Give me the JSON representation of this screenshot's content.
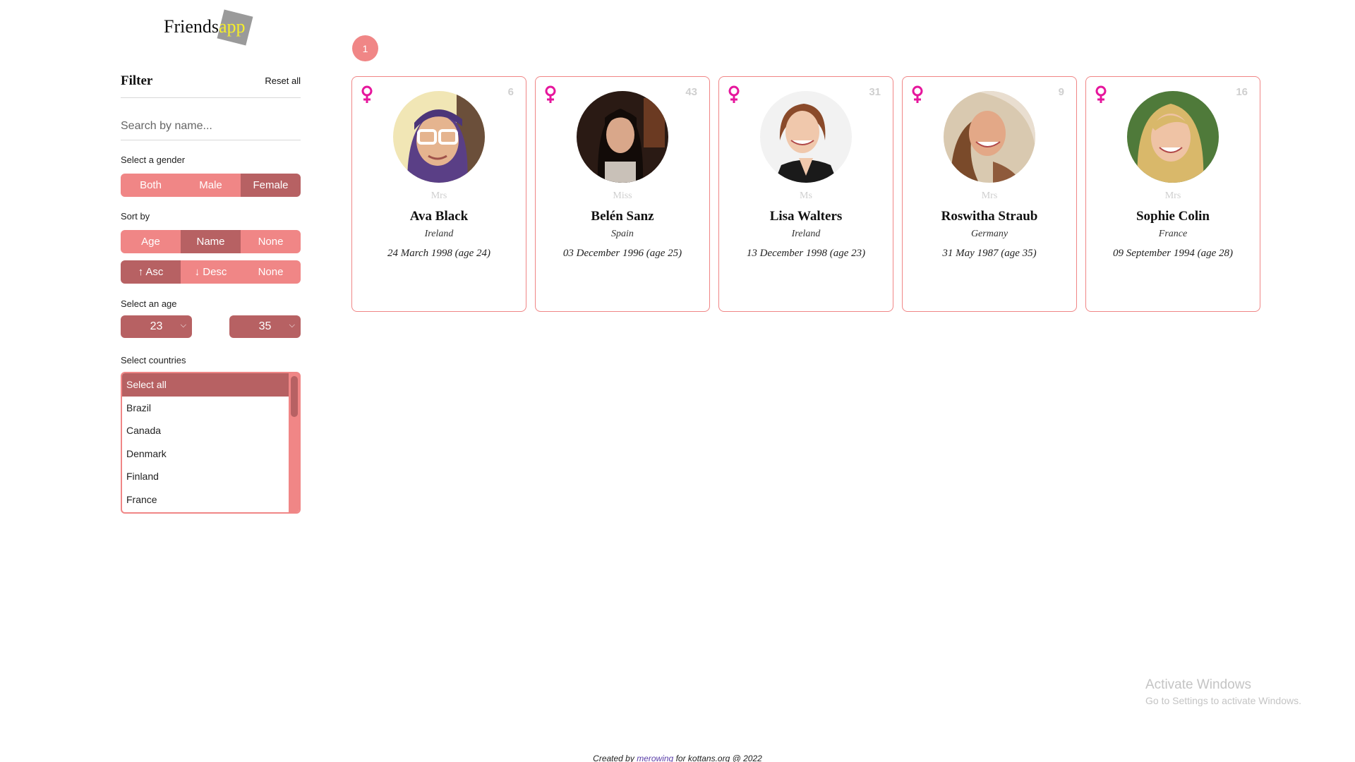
{
  "logo": {
    "text_main": "Friends",
    "text_accent": "app"
  },
  "sidebar": {
    "filter_title": "Filter",
    "reset_label": "Reset all",
    "search_placeholder": "Search by name...",
    "gender_label": "Select a gender",
    "gender_options": [
      "Both",
      "Male",
      "Female"
    ],
    "gender_selected": "Female",
    "sort_label": "Sort by",
    "sort_options": [
      "Age",
      "Name",
      "None"
    ],
    "sort_selected": "Name",
    "order_options": [
      "↑ Asc",
      "↓ Desc",
      "None"
    ],
    "order_selected": "↑ Asc",
    "age_label": "Select an age",
    "age_min": "23",
    "age_max": "35",
    "countries_label": "Select countries",
    "countries": [
      "Select all",
      "Brazil",
      "Canada",
      "Denmark",
      "Finland",
      "France"
    ],
    "countries_selected": "Select all"
  },
  "pagination": {
    "current_page": "1"
  },
  "cards": [
    {
      "number": "6",
      "title": "Mrs",
      "name": "Ava Black",
      "country": "Ireland",
      "dob": "24 March 1998 (age 24)",
      "gender_icon": "female-icon"
    },
    {
      "number": "43",
      "title": "Miss",
      "name": "Belén Sanz",
      "country": "Spain",
      "dob": "03 December 1996 (age 25)",
      "gender_icon": "female-icon"
    },
    {
      "number": "31",
      "title": "Ms",
      "name": "Lisa Walters",
      "country": "Ireland",
      "dob": "13 December 1998 (age 23)",
      "gender_icon": "female-icon"
    },
    {
      "number": "9",
      "title": "Mrs",
      "name": "Roswitha Straub",
      "country": "Germany",
      "dob": "31 May 1987 (age 35)",
      "gender_icon": "female-icon"
    },
    {
      "number": "16",
      "title": "Mrs",
      "name": "Sophie Colin",
      "country": "France",
      "dob": "09 September 1994 (age 28)",
      "gender_icon": "female-icon"
    }
  ],
  "watermark": {
    "title": "Activate Windows",
    "subtitle": "Go to Settings to activate Windows."
  },
  "footer": {
    "prefix": "Created by ",
    "author": "merowing",
    "suffix": " for kottans.org @ 2022"
  },
  "colors": {
    "accent": "#f08686",
    "accent_dark": "#b76163",
    "gender_female": "#e6169c"
  }
}
